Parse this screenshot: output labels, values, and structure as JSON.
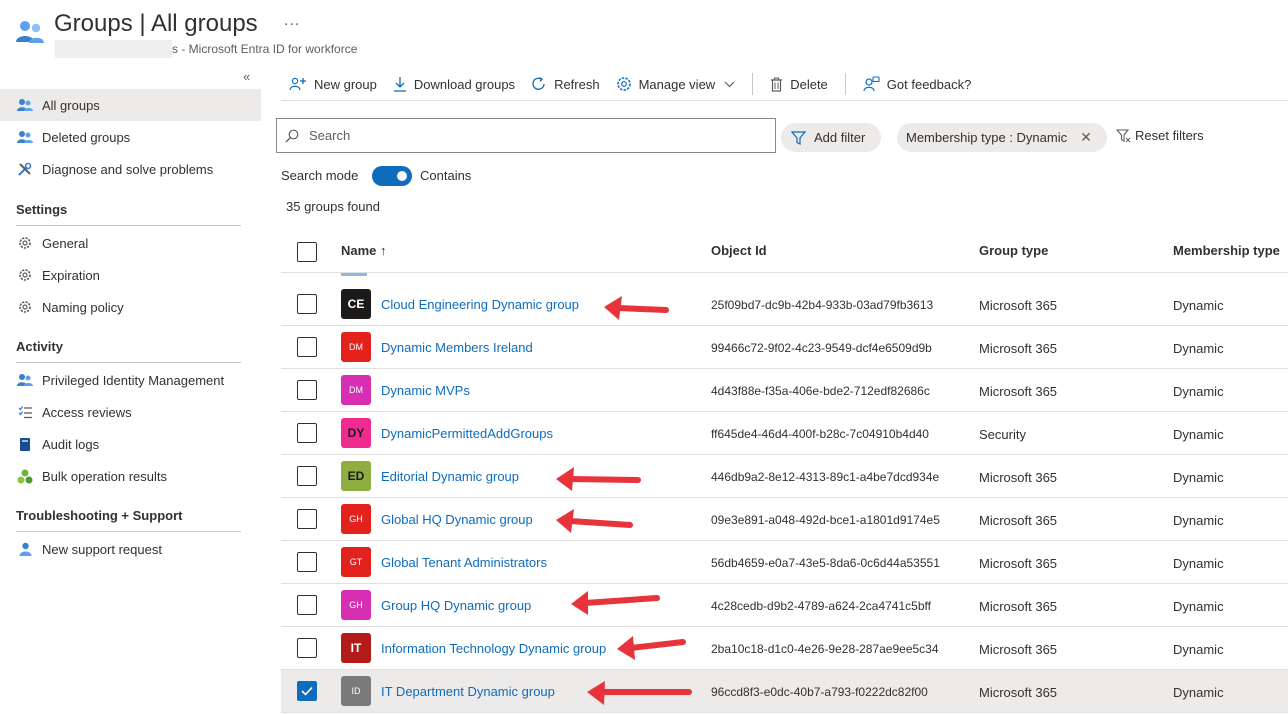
{
  "header": {
    "title": "Groups | All groups",
    "subtitle": "s - Microsoft Entra ID for workforce",
    "more": "..."
  },
  "sidebar": {
    "collapse": "«",
    "items": [
      {
        "label": "All groups",
        "icon": "groups-icon"
      },
      {
        "label": "Deleted groups",
        "icon": "groups-icon"
      },
      {
        "label": "Diagnose and solve problems",
        "icon": "wrench-icon"
      }
    ],
    "sections": [
      {
        "title": "Settings",
        "items": [
          {
            "label": "General",
            "icon": "gear-icon"
          },
          {
            "label": "Expiration",
            "icon": "gear-icon"
          },
          {
            "label": "Naming policy",
            "icon": "gear-icon"
          }
        ]
      },
      {
        "title": "Activity",
        "items": [
          {
            "label": "Privileged Identity Management",
            "icon": "pim-icon"
          },
          {
            "label": "Access reviews",
            "icon": "checklist-icon"
          },
          {
            "label": "Audit logs",
            "icon": "book-icon"
          },
          {
            "label": "Bulk operation results",
            "icon": "bulk-icon"
          }
        ]
      },
      {
        "title": "Troubleshooting + Support",
        "items": [
          {
            "label": "New support request",
            "icon": "person-icon"
          }
        ]
      }
    ]
  },
  "toolbar": {
    "new_group": "New group",
    "download_groups": "Download groups",
    "refresh": "Refresh",
    "manage_view": "Manage view",
    "delete": "Delete",
    "feedback": "Got feedback?"
  },
  "search": {
    "placeholder": "Search",
    "add_filter": "Add filter",
    "membership_filter": "Membership type : Dynamic",
    "reset_filters": "Reset filters",
    "mode_label": "Search mode",
    "mode_value": "Contains",
    "mode_on": true
  },
  "results": {
    "count_text": "35 groups found"
  },
  "table": {
    "columns": {
      "name": "Name ↑",
      "object_id": "Object Id",
      "group_type": "Group type",
      "membership_type": "Membership type"
    },
    "rows": [
      {
        "initials": "CE",
        "avatar_color": "#1b1a19",
        "name": "Cloud Engineering Dynamic group",
        "object_id": "25f09bd7-dc9b-42b4-933b-03ad79fb3613",
        "group_type": "Microsoft 365",
        "membership_type": "Dynamic",
        "checked": false,
        "arrow": true
      },
      {
        "initials": "DM",
        "avatar_color": "#e3221d",
        "name": "Dynamic Members Ireland",
        "object_id": "99466c72-9f02-4c23-9549-dcf4e6509d9b",
        "group_type": "Microsoft 365",
        "membership_type": "Dynamic",
        "checked": false,
        "arrow": false
      },
      {
        "initials": "DM",
        "avatar_color": "#d62fb4",
        "name": "Dynamic MVPs",
        "object_id": "4d43f88e-f35a-406e-bde2-712edf82686c",
        "group_type": "Microsoft 365",
        "membership_type": "Dynamic",
        "checked": false,
        "arrow": false
      },
      {
        "initials": "DY",
        "avatar_color": "#ef2b8f",
        "name": "DynamicPermittedAddGroups",
        "object_id": "ff645de4-46d4-400f-b28c-7c04910b4d40",
        "group_type": "Security",
        "membership_type": "Dynamic",
        "checked": false,
        "arrow": false
      },
      {
        "initials": "ED",
        "avatar_color": "#8fae3f",
        "name": "Editorial Dynamic group",
        "object_id": "446db9a2-8e12-4313-89c1-a4be7dcd934e",
        "group_type": "Microsoft 365",
        "membership_type": "Dynamic",
        "checked": false,
        "arrow": true
      },
      {
        "initials": "GH",
        "avatar_color": "#e3221d",
        "name": "Global HQ Dynamic group",
        "object_id": "09e3e891-a048-492d-bce1-a1801d9174e5",
        "group_type": "Microsoft 365",
        "membership_type": "Dynamic",
        "checked": false,
        "arrow": true
      },
      {
        "initials": "GT",
        "avatar_color": "#e3221d",
        "name": "Global Tenant Administrators",
        "object_id": "56db4659-e0a7-43e5-8da6-0c6d44a53551",
        "group_type": "Microsoft 365",
        "membership_type": "Dynamic",
        "checked": false,
        "arrow": false
      },
      {
        "initials": "GH",
        "avatar_color": "#d62fb4",
        "name": "Group HQ Dynamic group",
        "object_id": "4c28cedb-d9b2-4789-a624-2ca4741c5bff",
        "group_type": "Microsoft 365",
        "membership_type": "Dynamic",
        "checked": false,
        "arrow": true
      },
      {
        "initials": "IT",
        "avatar_color": "#b31b1b",
        "name": "Information Technology Dynamic group",
        "object_id": "2ba10c18-d1c0-4e26-9e28-287ae9ee5c34",
        "group_type": "Microsoft 365",
        "membership_type": "Dynamic",
        "checked": false,
        "arrow": true
      },
      {
        "initials": "ID",
        "avatar_color": "#7a7a7a",
        "name": "IT Department Dynamic group",
        "object_id": "96ccd8f3-e0dc-40b7-a793-f0222dc82f00",
        "group_type": "Microsoft 365",
        "membership_type": "Dynamic",
        "checked": true,
        "arrow": true
      }
    ]
  },
  "colors": {
    "accent": "#0f6cbd",
    "annotation_arrow": "#e8333a",
    "selected_row": "#edebe9"
  }
}
